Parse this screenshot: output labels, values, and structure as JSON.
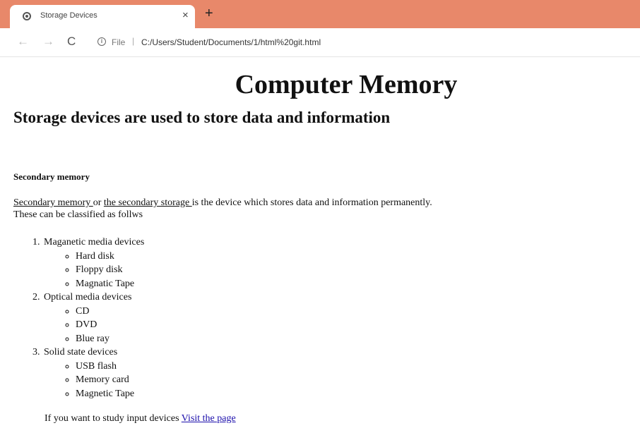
{
  "browser": {
    "tab_title": "Storage Devices",
    "tab_close": "×",
    "new_tab": "+",
    "nav": {
      "back": "←",
      "forward": "→",
      "reload": "C"
    },
    "address": {
      "file_label": "File",
      "separator": "|",
      "url": "C:/Users/Student/Documents/1/html%20git.html"
    }
  },
  "page": {
    "title": "Computer Memory",
    "subtitle": "Storage devices are used to store data and information",
    "section_heading": "Secondary memory",
    "intro": {
      "link1": "Secondary memory ",
      "text1": "or ",
      "link2": "the secondary storage ",
      "text2": "is the device which stores data and information permanently.",
      "line2": "These can be classified as follws"
    },
    "classes": [
      {
        "label": "Maganetic media devices",
        "items": [
          "Hard disk",
          "Floppy disk",
          "Magnatic Tape"
        ]
      },
      {
        "label": "Optical media devices",
        "items": [
          "CD",
          "DVD",
          "Blue ray"
        ]
      },
      {
        "label": "Solid state devices",
        "items": [
          "USB flash",
          "Memory card",
          "Magnetic Tape"
        ]
      }
    ],
    "footer": {
      "text": "If you want to study input devices ",
      "link": "Visit the page"
    }
  }
}
